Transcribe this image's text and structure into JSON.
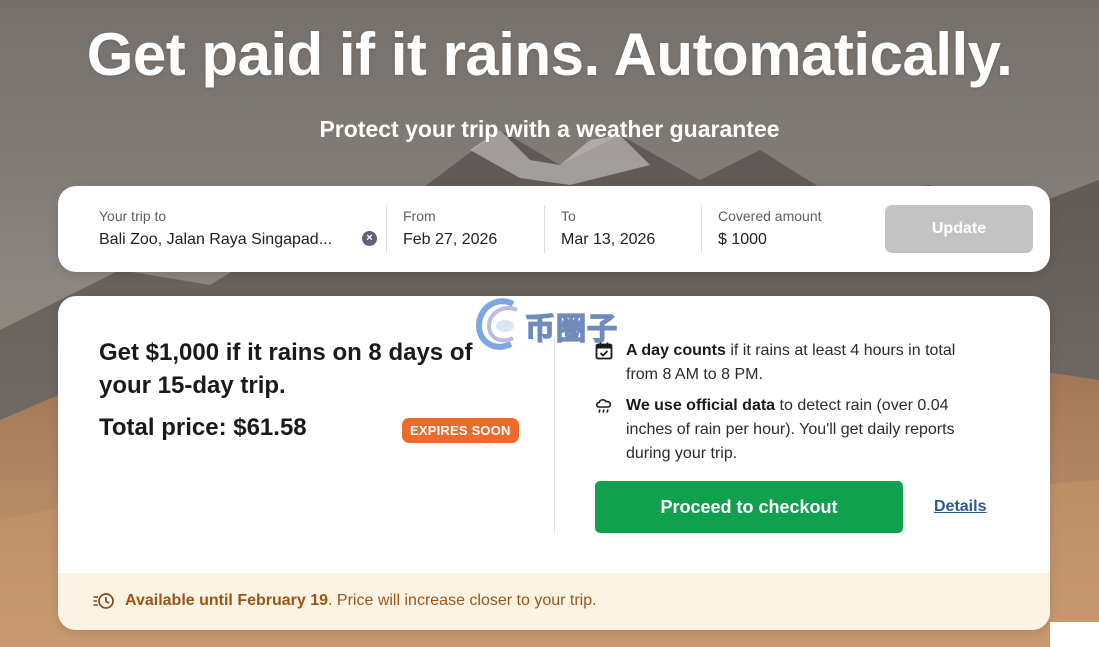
{
  "hero": {
    "title": "Get paid if it rains. Automatically.",
    "subtitle": "Protect your trip with a weather guarantee"
  },
  "search": {
    "trip_label": "Your trip to",
    "trip_value": "Bali Zoo, Jalan Raya Singapad...",
    "from_label": "From",
    "from_value": "Feb 27, 2026",
    "to_label": "To",
    "to_value": "Mar 13, 2026",
    "amount_label": "Covered amount",
    "amount_value": "$ 1000",
    "update_label": "Update",
    "icons": {
      "clear": "clear-x-icon"
    }
  },
  "offer": {
    "headline": "Get $1,000 if it rains on 8 days of your 15-day trip.",
    "total_price": "Total price: $61.58",
    "badge": "EXPIRES SOON",
    "info": [
      {
        "icon": "calendar-check-icon",
        "bold": "A day counts",
        "text": " if it rains at least 4 hours in total from 8 AM to 8 PM."
      },
      {
        "icon": "rain-cloud-icon",
        "bold": "We use official data",
        "text": " to detect rain (over 0.04 inches of rain per hour). You'll get daily reports during your trip."
      }
    ],
    "checkout_label": "Proceed to checkout",
    "details_label": "Details"
  },
  "banner": {
    "icon": "clock-fast-icon",
    "bold": "Available until February 19",
    "text": ". Price will increase closer to your trip."
  },
  "watermark": {
    "text": "币圈子"
  },
  "colors": {
    "primary_green": "#10a04e",
    "badge_orange": "#ed6a2b",
    "link_blue": "#2a5b8f",
    "banner_bg": "#fdf3e3",
    "banner_text": "#9a5414",
    "disabled_button": "#c3c3c3"
  }
}
